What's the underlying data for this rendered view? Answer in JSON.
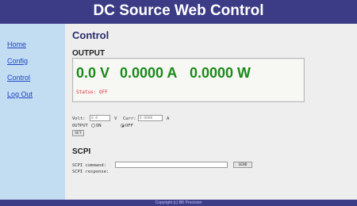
{
  "header": {
    "title": "DC Source Web Control"
  },
  "sidebar": {
    "items": [
      {
        "label": "Home"
      },
      {
        "label": "Config"
      },
      {
        "label": "Control"
      },
      {
        "label": "Log Out"
      }
    ]
  },
  "main": {
    "page_title": "Control",
    "output": {
      "title": "OUTPUT",
      "voltage": "0.0 V",
      "current": "0.0000 A",
      "power": "0.0000 W",
      "status": "Status: OFF"
    },
    "settings": {
      "volt_label": "Volt:",
      "volt_value": "0.0",
      "volt_unit": "V",
      "curr_label": "Curr:",
      "curr_value": "0.0000",
      "curr_unit": "A",
      "output_label": "OUTPUT",
      "on_label": "ON",
      "off_label": "OFF",
      "selected": "OFF",
      "set_button": "SET"
    },
    "scpi": {
      "title": "SCPI",
      "command_label": "SCPI command:",
      "command_value": "",
      "response_label": "SCPI response:",
      "send_button": "SEND"
    }
  },
  "footer": {
    "text": "Copyright (c) BK Precision"
  },
  "colors": {
    "header_bg": "#3b3b86",
    "sidebar_bg": "#c2dcf2",
    "readout_green": "#1a8a1a",
    "status_red": "#d03030",
    "link_blue": "#2046c8"
  }
}
